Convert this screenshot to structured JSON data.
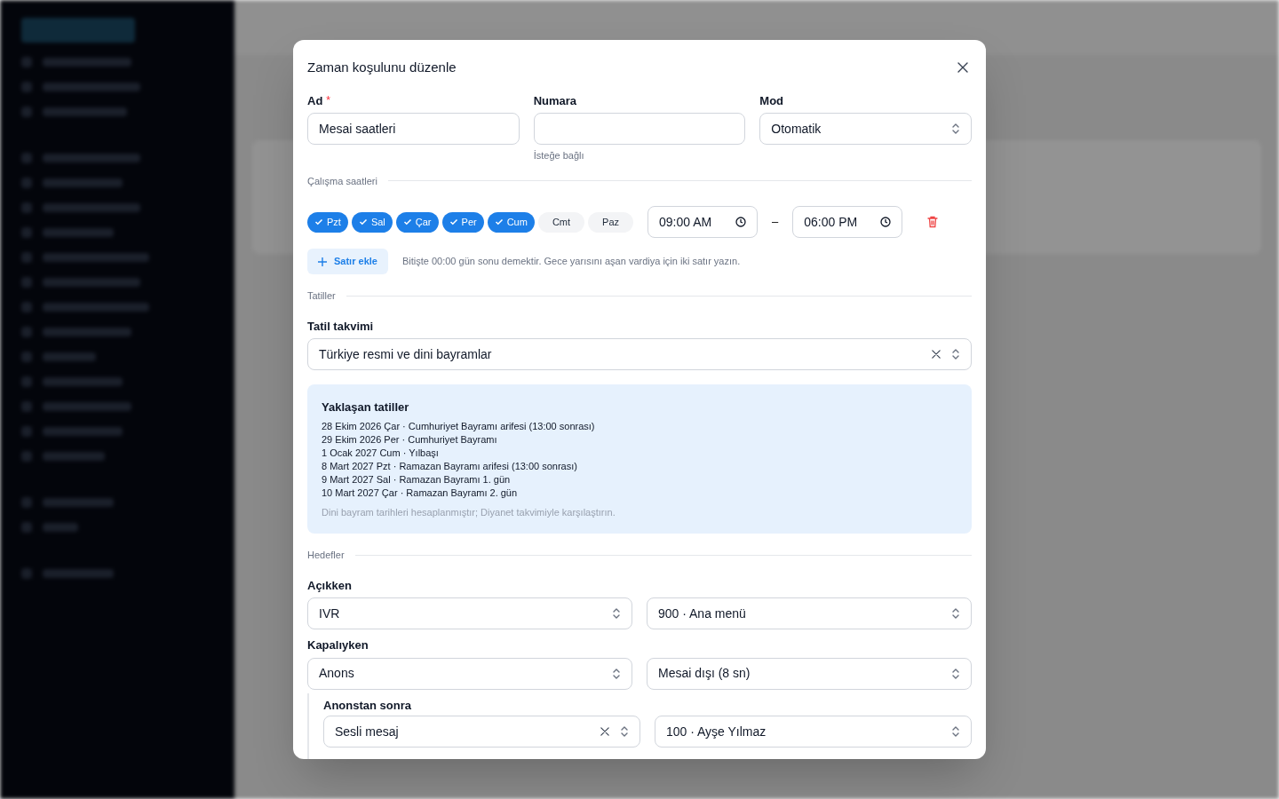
{
  "dialog": {
    "title": "Zaman koşulunu düzenle",
    "fields": [
      {
        "label": "Ad",
        "required_mark": "*",
        "kind": "input",
        "value": "Mesai saatleri"
      },
      {
        "label": "Numara",
        "kind": "input",
        "hint": "İsteğe bağlı"
      },
      {
        "label": "Mod",
        "kind": "select",
        "value": "Otomatik"
      }
    ],
    "hours_section": "Çalışma saatleri",
    "days": [
      {
        "label": "Pzt",
        "selected": true
      },
      {
        "label": "Sal",
        "selected": true
      },
      {
        "label": "Çar",
        "selected": true
      },
      {
        "label": "Per",
        "selected": true
      },
      {
        "label": "Cum",
        "selected": true
      },
      {
        "label": "Cmt",
        "selected": false
      },
      {
        "label": "Paz",
        "selected": false
      }
    ],
    "start_time": "09:00 AM",
    "separator": "–",
    "end_time": "06:00 PM",
    "add_row_button": "Satır ekle",
    "hours_note": "Bitişte 00:00 gün sonu demektir. Gece yarısını aşan vardiya için iki satır yazın.",
    "holidays_section": "Tatiller",
    "holiday_calendar": {
      "label": "Tatil takvimi",
      "value": "Türkiye resmi ve dini bayramlar"
    },
    "upcoming": {
      "title": "Yaklaşan tatiller",
      "items": [
        "28 Ekim 2026 Çar · Cumhuriyet Bayramı arifesi (13:00 sonrası)",
        "29 Ekim 2026 Per · Cumhuriyet Bayramı",
        "1 Ocak 2027 Cum · Yılbaşı",
        "8 Mart 2027 Pzt · Ramazan Bayramı arifesi (13:00 sonrası)",
        "9 Mart 2027 Sal · Ramazan Bayramı 1. gün",
        "10 Mart 2027 Çar · Ramazan Bayramı 2. gün"
      ],
      "note": "Dini bayram tarihleri hesaplanmıştır; Diyanet takvimiyle karşılaştırın."
    },
    "targets_section": "Hedefler",
    "targets": [
      {
        "label": "Açıkken",
        "type": "IVR",
        "destination": "900 · Ana menü"
      },
      {
        "label": "Kapalıyken",
        "type": "Anons",
        "destination": "Mesai dışı (8 sn)"
      }
    ],
    "after": {
      "label": "Anonstan sonra",
      "type": "Sesli mesaj",
      "destination": "100 · Ayşe Yılmaz"
    }
  }
}
